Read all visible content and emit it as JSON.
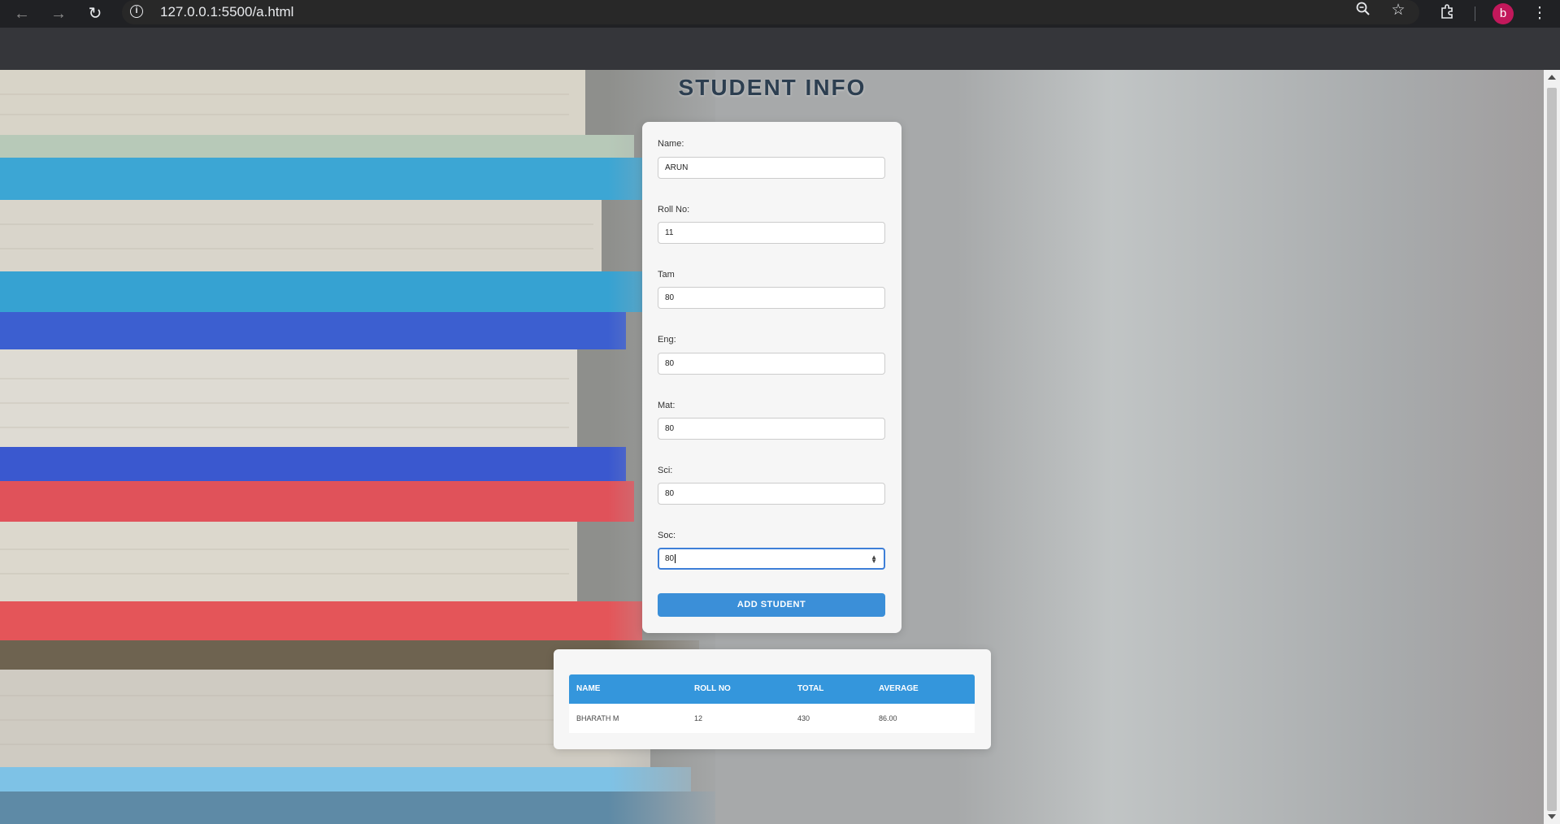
{
  "browser": {
    "url": "127.0.0.1:5500/a.html",
    "profile_initial": "b"
  },
  "page": {
    "title": "STUDENT INFO"
  },
  "form": {
    "fields": [
      {
        "label": "Name:",
        "value": "ARUN"
      },
      {
        "label": "Roll No:",
        "value": "11"
      },
      {
        "label": "Tam",
        "value": "80"
      },
      {
        "label": "Eng:",
        "value": "80"
      },
      {
        "label": "Mat:",
        "value": "80"
      },
      {
        "label": "Sci:",
        "value": "80"
      },
      {
        "label": "Soc:",
        "value": "80"
      }
    ],
    "submit_label": "ADD STUDENT"
  },
  "table": {
    "headers": [
      "NAME",
      "ROLL NO",
      "TOTAL",
      "AVERAGE"
    ],
    "rows": [
      [
        "BHARATH M",
        "12",
        "430",
        "86.00"
      ]
    ]
  },
  "colors": {
    "accent": "#3b8fd8",
    "table_header": "#3496dc",
    "title": "#2c3e50",
    "avatar": "#c2185b"
  }
}
